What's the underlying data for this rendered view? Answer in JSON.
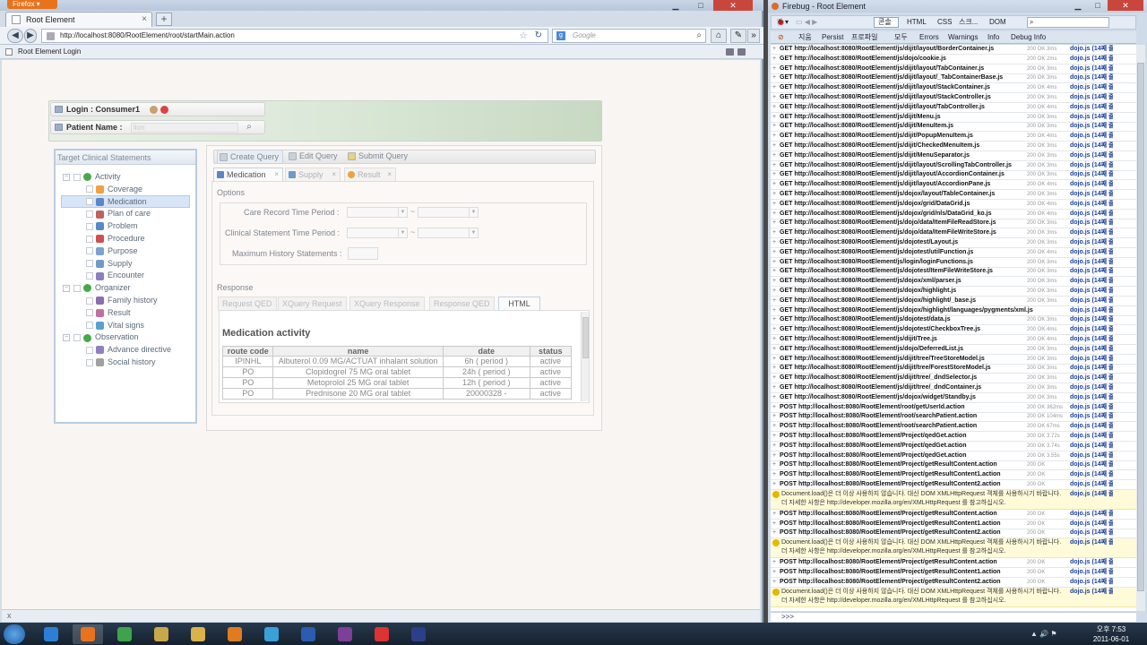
{
  "firefox": {
    "menu_button": "Firefox",
    "tab_title": "Root Element",
    "new_tab_symbol": "+",
    "url": "http://localhost:8080/RootElement/root/startMain.action",
    "search_placeholder": "Google",
    "bookmark_label": "Root Element Login",
    "status_text": "x"
  },
  "app": {
    "login_label": "Login : Consumer1",
    "patient_label": "Patient Name :",
    "patient_value": "lion",
    "left_panel_title": "Target Clinical Statements",
    "tree": [
      {
        "label": "Activity",
        "level": 0,
        "color": "#47a847"
      },
      {
        "label": "Coverage",
        "level": 1,
        "color": "#f0a040"
      },
      {
        "label": "Medication",
        "level": 1,
        "color": "#5b86c8"
      },
      {
        "label": "Plan of care",
        "level": 1,
        "color": "#c06060"
      },
      {
        "label": "Problem",
        "level": 1,
        "color": "#5588cc"
      },
      {
        "label": "Procedure",
        "level": 1,
        "color": "#d05050"
      },
      {
        "label": "Purpose",
        "level": 1,
        "color": "#7ca0d0"
      },
      {
        "label": "Supply",
        "level": 1,
        "color": "#6f9ac8"
      },
      {
        "label": "Encounter",
        "level": 1,
        "color": "#8b7fc0"
      },
      {
        "label": "Organizer",
        "level": 0,
        "color": "#47a847"
      },
      {
        "label": "Family history",
        "level": 1,
        "color": "#8a6fb0"
      },
      {
        "label": "Result",
        "level": 1,
        "color": "#c070a0"
      },
      {
        "label": "Vital signs",
        "level": 1,
        "color": "#5aa0d0"
      },
      {
        "label": "Observation",
        "level": 0,
        "color": "#47a847"
      },
      {
        "label": "Advance directive",
        "level": 1,
        "color": "#9080c0"
      },
      {
        "label": "Social history",
        "level": 1,
        "color": "#a0a0a0"
      }
    ],
    "toolbar": {
      "create": "Create Query",
      "edit": "Edit Query",
      "submit": "Submit Query"
    },
    "query_tabs": {
      "medication": "Medication",
      "supply": "Supply",
      "result": "Result"
    },
    "options_label": "Options",
    "care_record_label": "Care Record Time Period :",
    "clinical_statement_label": "Clinical Statement Time Period :",
    "max_history_label": "Maximum History Statements :",
    "range_separator": "~",
    "response_label": "Response",
    "response_tabs": {
      "request_qed": "Request QED",
      "xquery_request": "XQuery Request",
      "xquery_response": "XQuery Response",
      "response_qed": "Response QED",
      "html": "HTML"
    },
    "result_title": "Medication activity",
    "table_headers": [
      "route code",
      "name",
      "date",
      "status"
    ],
    "table_rows": [
      [
        "IPINHL",
        "Albuterol 0.09 MG/ACTUAT inhalant solution",
        "6h ( period )",
        "active"
      ],
      [
        "PO",
        "Clopidogrel 75 MG oral tablet",
        "24h ( period )",
        "active"
      ],
      [
        "PO",
        "Metoprolol 25 MG oral tablet",
        "12h ( period )",
        "active"
      ],
      [
        "PO",
        "Prednisone 20 MG oral tablet",
        "20000328 -",
        "active"
      ]
    ]
  },
  "firebug": {
    "title": "Firebug - Root Element",
    "toolbar_tabs": [
      "콘솔",
      "HTML",
      "CSS",
      "스크...",
      "DOM"
    ],
    "filter_tabs": [
      "지움",
      "Persist",
      "프로파일",
      "모두",
      "Errors",
      "Warnings",
      "Info",
      "Debug Info"
    ],
    "source_link": "dojo.js (14째 줄)",
    "cmd_prompt": ">>>",
    "warning_text": "Document.load()은 더 이상 사용하지 않습니다. 대신 DOM XMLHttpRequest 객체를 사용하시기 바랍니다. 더 자세한 사항은 http://developer.mozilla.org/en/XMLHttpRequest 를 참고하십시오.",
    "log": [
      {
        "m": "GET http://localhost:8080/RootElement/js/dijit/layout/BorderContainer.js",
        "s": "200 OK 3ms"
      },
      {
        "m": "GET http://localhost:8080/RootElement/js/dojo/cookie.js",
        "s": "200 OK 2ms"
      },
      {
        "m": "GET http://localhost:8080/RootElement/js/dijit/layout/TabContainer.js",
        "s": "200 OK 3ms"
      },
      {
        "m": "GET http://localhost:8080/RootElement/js/dijit/layout/_TabContainerBase.js",
        "s": "200 OK 3ms"
      },
      {
        "m": "GET http://localhost:8080/RootElement/js/dijit/layout/StackContainer.js",
        "s": "200 OK 4ms"
      },
      {
        "m": "GET http://localhost:8080/RootElement/js/dijit/layout/StackController.js",
        "s": "200 OK 3ms"
      },
      {
        "m": "GET http://localhost:8080/RootElement/js/dijit/layout/TabController.js",
        "s": "200 OK 4ms"
      },
      {
        "m": "GET http://localhost:8080/RootElement/js/dijit/Menu.js",
        "s": "200 OK 3ms"
      },
      {
        "m": "GET http://localhost:8080/RootElement/js/dijit/MenuItem.js",
        "s": "200 OK 3ms"
      },
      {
        "m": "GET http://localhost:8080/RootElement/js/dijit/PopupMenuItem.js",
        "s": "200 OK 4ms"
      },
      {
        "m": "GET http://localhost:8080/RootElement/js/dijit/CheckedMenuItem.js",
        "s": "200 OK 3ms"
      },
      {
        "m": "GET http://localhost:8080/RootElement/js/dijit/MenuSeparator.js",
        "s": "200 OK 3ms"
      },
      {
        "m": "GET http://localhost:8080/RootElement/js/dijit/layout/ScrollingTabController.js",
        "s": "200 OK 3ms"
      },
      {
        "m": "GET http://localhost:8080/RootElement/js/dijit/layout/AccordionContainer.js",
        "s": "200 OK 3ms"
      },
      {
        "m": "GET http://localhost:8080/RootElement/js/dijit/layout/AccordionPane.js",
        "s": "200 OK 4ms"
      },
      {
        "m": "GET http://localhost:8080/RootElement/js/dojox/layout/TableContainer.js",
        "s": "200 OK 3ms"
      },
      {
        "m": "GET http://localhost:8080/RootElement/js/dojox/grid/DataGrid.js",
        "s": "200 OK 4ms"
      },
      {
        "m": "GET http://localhost:8080/RootElement/js/dojox/grid/nls/DataGrid_ko.js",
        "s": "200 OK 4ms"
      },
      {
        "m": "GET http://localhost:8080/RootElement/js/dojo/data/ItemFileReadStore.js",
        "s": "200 OK 3ms"
      },
      {
        "m": "GET http://localhost:8080/RootElement/js/dojo/data/ItemFileWriteStore.js",
        "s": "200 OK 3ms"
      },
      {
        "m": "GET http://localhost:8080/RootElement/js/dojotest/Layout.js",
        "s": "200 OK 3ms"
      },
      {
        "m": "GET http://localhost:8080/RootElement/js/dojotest/utilFunction.js",
        "s": "200 OK 4ms"
      },
      {
        "m": "GET http://localhost:8080/RootElement/js/login/loginFunctions.js",
        "s": "200 OK 3ms"
      },
      {
        "m": "GET http://localhost:8080/RootElement/js/dojotest/ItemFileWriteStore.js",
        "s": "200 OK 3ms"
      },
      {
        "m": "GET http://localhost:8080/RootElement/js/dojox/xml/parser.js",
        "s": "200 OK 3ms"
      },
      {
        "m": "GET http://localhost:8080/RootElement/js/dojox/highlight.js",
        "s": "200 OK 3ms"
      },
      {
        "m": "GET http://localhost:8080/RootElement/js/dojox/highlight/_base.js",
        "s": "200 OK 3ms"
      },
      {
        "m": "GET http://localhost:8080/RootElement/js/dojox/highlight/languages/pygments/xml.js",
        "s": ""
      },
      {
        "m": "GET http://localhost:8080/RootElement/js/dojotest/data.js",
        "s": "200 OK 3ms"
      },
      {
        "m": "GET http://localhost:8080/RootElement/js/dojotest/CheckboxTree.js",
        "s": "200 OK 4ms"
      },
      {
        "m": "GET http://localhost:8080/RootElement/js/dijit/Tree.js",
        "s": "200 OK 4ms"
      },
      {
        "m": "GET http://localhost:8080/RootElement/js/dojo/DeferredList.js",
        "s": "200 OK 3ms"
      },
      {
        "m": "GET http://localhost:8080/RootElement/js/dijit/tree/TreeStoreModel.js",
        "s": "200 OK 3ms"
      },
      {
        "m": "GET http://localhost:8080/RootElement/js/dijit/tree/ForestStoreModel.js",
        "s": "200 OK 3ms"
      },
      {
        "m": "GET http://localhost:8080/RootElement/js/dijit/tree/_dndSelector.js",
        "s": "200 OK 3ms"
      },
      {
        "m": "GET http://localhost:8080/RootElement/js/dijit/tree/_dndContainer.js",
        "s": "200 OK 3ms"
      },
      {
        "m": "GET http://localhost:8080/RootElement/js/dojox/widget/Standby.js",
        "s": "200 OK 3ms"
      },
      {
        "m": "POST http://localhost:8080/RootElement/root/getUserId.action",
        "s": "200 OK 362ms"
      },
      {
        "m": "POST http://localhost:8080/RootElement/root/searchPatient.action",
        "s": "200 OK 104ms"
      },
      {
        "m": "POST http://localhost:8080/RootElement/root/searchPatient.action",
        "s": "200 OK 67ms"
      },
      {
        "m": "POST http://localhost:8080/RootElement/Project/qedGet.action",
        "s": "200 OK 3.72s"
      },
      {
        "m": "POST http://localhost:8080/RootElement/Project/qedGet.action",
        "s": "200 OK 3.74s"
      },
      {
        "m": "POST http://localhost:8080/RootElement/Project/qedGet.action",
        "s": "200 OK 3.55s"
      },
      {
        "m": "POST http://localhost:8080/RootElement/Project/getResultContent.action",
        "s": "200 OK"
      },
      {
        "m": "POST http://localhost:8080/RootElement/Project/getResultContent1.action",
        "s": "200 OK"
      },
      {
        "m": "POST http://localhost:8080/RootElement/Project/getResultContent2.action",
        "s": "200 OK"
      },
      {
        "warn": true
      },
      {
        "m": "POST http://localhost:8080/RootElement/Project/getResultContent.action",
        "s": "200 OK"
      },
      {
        "m": "POST http://localhost:8080/RootElement/Project/getResultContent1.action",
        "s": "200 OK"
      },
      {
        "m": "POST http://localhost:8080/RootElement/Project/getResultContent2.action",
        "s": "200 OK"
      },
      {
        "warn": true
      },
      {
        "m": "POST http://localhost:8080/RootElement/Project/getResultContent.action",
        "s": "200 OK"
      },
      {
        "m": "POST http://localhost:8080/RootElement/Project/getResultContent1.action",
        "s": "200 OK"
      },
      {
        "m": "POST http://localhost:8080/RootElement/Project/getResultContent2.action",
        "s": "200 OK"
      },
      {
        "warn": true
      }
    ]
  },
  "taskbar": {
    "apps": [
      "internet-explorer",
      "firefox",
      "chrome",
      "explorer",
      "folder",
      "outlook",
      "messenger",
      "word",
      "onenote",
      "xmind",
      "media"
    ],
    "clock_time": "오후 7:53",
    "clock_date": "2011-06-01"
  }
}
